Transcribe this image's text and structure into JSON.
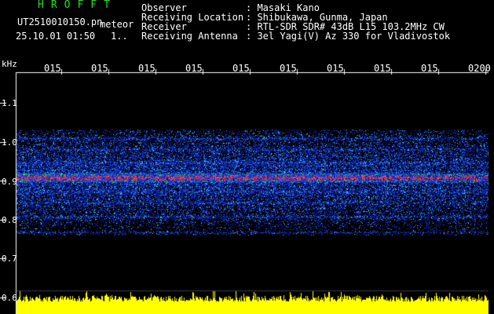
{
  "header": {
    "app_title": "HROFFT",
    "file_name": "UT2510010150.pn",
    "mode": "meteor",
    "datetime": "25.10.01 01:50",
    "ellipsis": "1..",
    "info": [
      {
        "label": "Observer",
        "value": ": Masaki Kano"
      },
      {
        "label": "Receiving Location",
        "value": ": Shibukawa, Gunma, Japan"
      },
      {
        "label": "Receiver",
        "value": ": RTL-SDR SDR# 43dB L15 103.2MHz CW"
      },
      {
        "label": "Receiving Antenna",
        "value": ": 3el Yagi(V) Az 330 for Vladivostok"
      }
    ]
  },
  "axis": {
    "unit": "kHz",
    "y_ticks": [
      "1.1",
      "1.0",
      "0.9",
      "0.8",
      "0.7",
      "0.6"
    ],
    "x_ticks": [
      "015",
      "015",
      "015",
      "015",
      "015",
      "015",
      "015",
      "015",
      "015",
      "0200"
    ]
  },
  "colors": {
    "title_green": "#1fe01f",
    "noise_blue": "#1e3cff",
    "signal_red": "#ff2020",
    "level_yellow": "#ffff00"
  }
}
